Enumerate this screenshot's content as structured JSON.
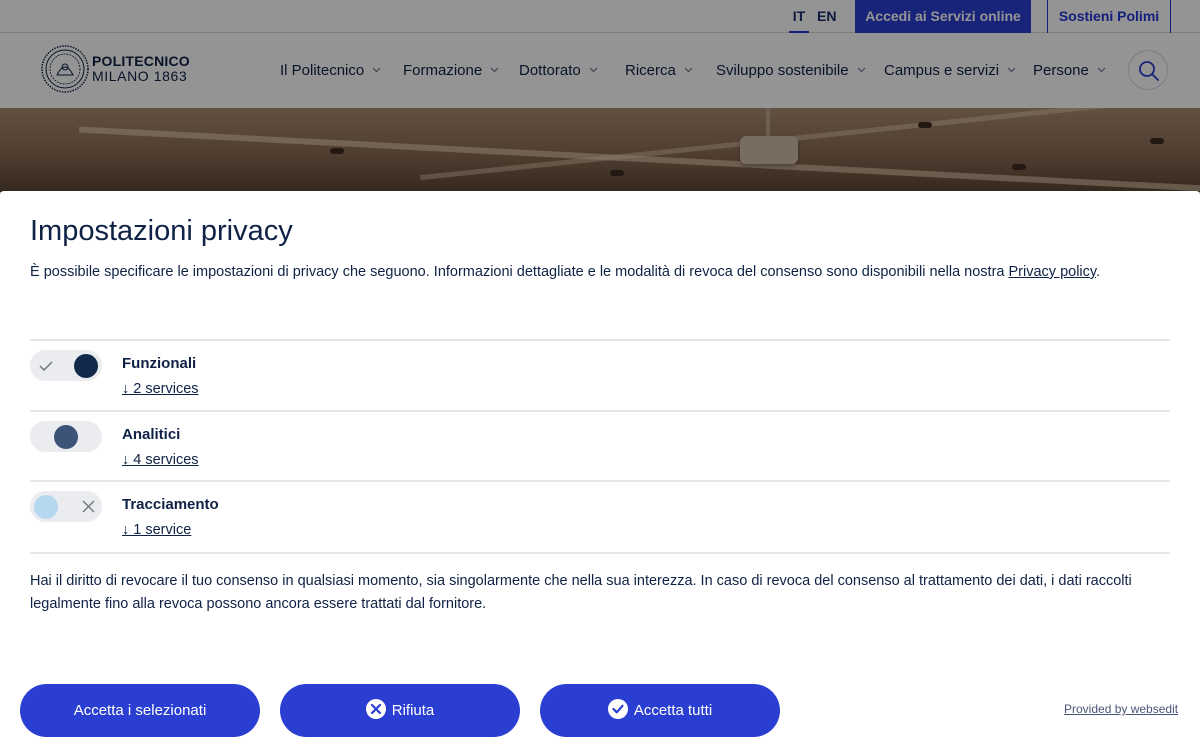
{
  "utility": {
    "languages": [
      "IT",
      "EN"
    ],
    "accedi_label": "Accedi ai Servizi online",
    "sostieni_label": "Sostieni Polimi"
  },
  "logo": {
    "line1": "POLITECNICO",
    "line2": "MILANO 1863"
  },
  "nav": [
    {
      "label": "Il Politecnico"
    },
    {
      "label": "Formazione"
    },
    {
      "label": "Dottorato"
    },
    {
      "label": "Ricerca"
    },
    {
      "label": "Sviluppo sostenibile"
    },
    {
      "label": "Campus e servizi"
    },
    {
      "label": "Persone"
    }
  ],
  "privacy": {
    "title": "Impostazioni privacy",
    "intro": "È possibile specificare le impostazioni di privacy che seguono. Informazioni dettagliate e le modalità di revoca del consenso sono disponibili nella nostra ",
    "policy_link": "Privacy policy",
    "intro_end": ".",
    "categories": [
      {
        "label": "Funzionali",
        "services": "↓ 2 services",
        "state": "on"
      },
      {
        "label": "Analitici",
        "services": "↓ 4 services",
        "state": "partial"
      },
      {
        "label": "Tracciamento",
        "services": "↓ 1 service",
        "state": "off"
      }
    ],
    "note": "Hai il diritto di revocare il tuo consenso in qualsiasi momento, sia singolarmente che nella sua interezza. In caso di revoca del consenso al trattamento dei dati, i dati raccolti legalmente fino alla revoca possono ancora essere trattati dal fornitore."
  },
  "buttons": {
    "accept_selected": "Accetta i selezionati",
    "reject": "Rifiuta",
    "accept_all": "Accetta tutti"
  },
  "provided_by": "Provided by websedit",
  "colors": {
    "brand_blue": "#2a3fd1",
    "navy": "#0f2245",
    "toggle_on": "#13294b",
    "toggle_partial": "#3c5478",
    "toggle_off": "#b5d8f0"
  }
}
